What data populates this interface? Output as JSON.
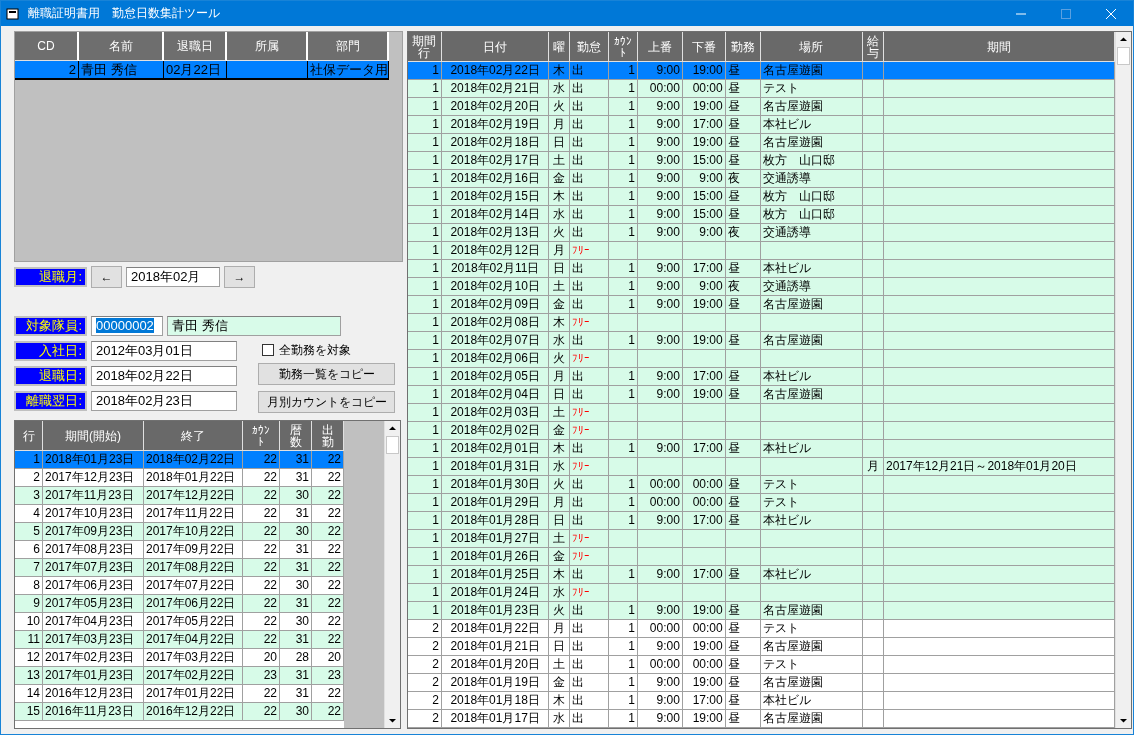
{
  "window": {
    "title": "離職証明書用　勤怠日数集計ツール"
  },
  "staff_table": {
    "columns": [
      "CD",
      "名前",
      "退職日",
      "所属",
      "部門"
    ],
    "rows": [
      {
        "cd": "2",
        "name": "青田 秀信",
        "retire_date": "02月22日",
        "department": "社保データ用",
        "selected": true
      }
    ]
  },
  "retire_month": {
    "label": "退職月:",
    "prev": "←",
    "value": "2018年02月",
    "next": "→"
  },
  "member": {
    "label": "対象隊員:",
    "code": "00000002",
    "name": "青田 秀信"
  },
  "dates": [
    {
      "label": "入社日:",
      "value": "2012年03月01日"
    },
    {
      "label": "退職日:",
      "value": "2018年02月22日"
    },
    {
      "label": "離職翌日:",
      "value": "2018年02月23日"
    }
  ],
  "all_shifts": {
    "label": "全勤務を対象",
    "checked": false
  },
  "buttons": [
    "勤務一覧をコピー",
    "月別カウントをコピー"
  ],
  "period_table": {
    "columns": [
      "行",
      "期間(開始)",
      "終了",
      "ｶｳﾝﾄ",
      "暦数",
      "出勤"
    ],
    "rows": [
      {
        "row": "1",
        "start": "2018年01月23日",
        "end": "2018年02月22日",
        "count": "22",
        "days": "31",
        "worked": "22",
        "selected": true,
        "shaded": false
      },
      {
        "row": "2",
        "start": "2017年12月23日",
        "end": "2018年01月22日",
        "count": "22",
        "days": "31",
        "worked": "22",
        "selected": false,
        "shaded": false
      },
      {
        "row": "3",
        "start": "2017年11月23日",
        "end": "2017年12月22日",
        "count": "22",
        "days": "30",
        "worked": "22",
        "selected": false,
        "shaded": true
      },
      {
        "row": "4",
        "start": "2017年10月23日",
        "end": "2017年11月22日",
        "count": "22",
        "days": "31",
        "worked": "22",
        "selected": false,
        "shaded": false
      },
      {
        "row": "5",
        "start": "2017年09月23日",
        "end": "2017年10月22日",
        "count": "22",
        "days": "30",
        "worked": "22",
        "selected": false,
        "shaded": true
      },
      {
        "row": "6",
        "start": "2017年08月23日",
        "end": "2017年09月22日",
        "count": "22",
        "days": "31",
        "worked": "22",
        "selected": false,
        "shaded": false
      },
      {
        "row": "7",
        "start": "2017年07月23日",
        "end": "2017年08月22日",
        "count": "22",
        "days": "31",
        "worked": "22",
        "selected": false,
        "shaded": true
      },
      {
        "row": "8",
        "start": "2017年06月23日",
        "end": "2017年07月22日",
        "count": "22",
        "days": "30",
        "worked": "22",
        "selected": false,
        "shaded": false
      },
      {
        "row": "9",
        "start": "2017年05月23日",
        "end": "2017年06月22日",
        "count": "22",
        "days": "31",
        "worked": "22",
        "selected": false,
        "shaded": true
      },
      {
        "row": "10",
        "start": "2017年04月23日",
        "end": "2017年05月22日",
        "count": "22",
        "days": "30",
        "worked": "22",
        "selected": false,
        "shaded": false
      },
      {
        "row": "11",
        "start": "2017年03月23日",
        "end": "2017年04月22日",
        "count": "22",
        "days": "31",
        "worked": "22",
        "selected": false,
        "shaded": true
      },
      {
        "row": "12",
        "start": "2017年02月23日",
        "end": "2017年03月22日",
        "count": "20",
        "days": "28",
        "worked": "20",
        "selected": false,
        "shaded": false
      },
      {
        "row": "13",
        "start": "2017年01月23日",
        "end": "2017年02月22日",
        "count": "23",
        "days": "31",
        "worked": "23",
        "selected": false,
        "shaded": true
      },
      {
        "row": "14",
        "start": "2016年12月23日",
        "end": "2017年01月22日",
        "count": "22",
        "days": "31",
        "worked": "22",
        "selected": false,
        "shaded": false
      },
      {
        "row": "15",
        "start": "2016年11月23日",
        "end": "2016年12月22日",
        "count": "22",
        "days": "30",
        "worked": "22",
        "selected": false,
        "shaded": true
      }
    ]
  },
  "attendance_table": {
    "columns": [
      "期間行",
      "日付",
      "曜",
      "勤怠",
      "ｶｳﾝﾄ",
      "上番",
      "下番",
      "勤務",
      "場所",
      "給与",
      "期間"
    ],
    "rows": [
      {
        "period": "1",
        "date": "2018年02月22日",
        "weekday": "木",
        "status": "出",
        "kind": "work",
        "count": "1",
        "start": "9:00",
        "end": "19:00",
        "shift": "昼",
        "place": "名古屋遊園",
        "selected": true,
        "shaded": true
      },
      {
        "period": "1",
        "date": "2018年02月21日",
        "weekday": "水",
        "status": "出",
        "kind": "work",
        "count": "1",
        "start": "00:00",
        "end": "00:00",
        "shift": "昼",
        "place": "テスト",
        "selected": false,
        "shaded": true
      },
      {
        "period": "1",
        "date": "2018年02月20日",
        "weekday": "火",
        "status": "出",
        "kind": "work",
        "count": "1",
        "start": "9:00",
        "end": "19:00",
        "shift": "昼",
        "place": "名古屋遊園",
        "selected": false,
        "shaded": true
      },
      {
        "period": "1",
        "date": "2018年02月19日",
        "weekday": "月",
        "status": "出",
        "kind": "work",
        "count": "1",
        "start": "9:00",
        "end": "17:00",
        "shift": "昼",
        "place": "本社ビル",
        "selected": false,
        "shaded": true
      },
      {
        "period": "1",
        "date": "2018年02月18日",
        "weekday": "日",
        "status": "出",
        "kind": "work",
        "count": "1",
        "start": "9:00",
        "end": "19:00",
        "shift": "昼",
        "place": "名古屋遊園",
        "selected": false,
        "shaded": true
      },
      {
        "period": "1",
        "date": "2018年02月17日",
        "weekday": "土",
        "status": "出",
        "kind": "work",
        "count": "1",
        "start": "9:00",
        "end": "15:00",
        "shift": "昼",
        "place": "枚方　山口邸",
        "selected": false,
        "shaded": true
      },
      {
        "period": "1",
        "date": "2018年02月16日",
        "weekday": "金",
        "status": "出",
        "kind": "work",
        "count": "1",
        "start": "9:00",
        "end": "9:00",
        "shift": "夜",
        "place": "交通誘導",
        "selected": false,
        "shaded": true
      },
      {
        "period": "1",
        "date": "2018年02月15日",
        "weekday": "木",
        "status": "出",
        "kind": "work",
        "count": "1",
        "start": "9:00",
        "end": "15:00",
        "shift": "昼",
        "place": "枚方　山口邸",
        "selected": false,
        "shaded": true
      },
      {
        "period": "1",
        "date": "2018年02月14日",
        "weekday": "水",
        "status": "出",
        "kind": "work",
        "count": "1",
        "start": "9:00",
        "end": "15:00",
        "shift": "昼",
        "place": "枚方　山口邸",
        "selected": false,
        "shaded": true
      },
      {
        "period": "1",
        "date": "2018年02月13日",
        "weekday": "火",
        "status": "出",
        "kind": "work",
        "count": "1",
        "start": "9:00",
        "end": "9:00",
        "shift": "夜",
        "place": "交通誘導",
        "selected": false,
        "shaded": true
      },
      {
        "period": "1",
        "date": "2018年02月12日",
        "weekday": "月",
        "status": "ﾌﾘｰ",
        "kind": "free",
        "selected": false,
        "shaded": true
      },
      {
        "period": "1",
        "date": "2018年02月11日",
        "weekday": "日",
        "status": "出",
        "kind": "work",
        "count": "1",
        "start": "9:00",
        "end": "17:00",
        "shift": "昼",
        "place": "本社ビル",
        "selected": false,
        "shaded": true
      },
      {
        "period": "1",
        "date": "2018年02月10日",
        "weekday": "土",
        "status": "出",
        "kind": "work",
        "count": "1",
        "start": "9:00",
        "end": "9:00",
        "shift": "夜",
        "place": "交通誘導",
        "selected": false,
        "shaded": true
      },
      {
        "period": "1",
        "date": "2018年02月09日",
        "weekday": "金",
        "status": "出",
        "kind": "work",
        "count": "1",
        "start": "9:00",
        "end": "19:00",
        "shift": "昼",
        "place": "名古屋遊園",
        "selected": false,
        "shaded": true
      },
      {
        "period": "1",
        "date": "2018年02月08日",
        "weekday": "木",
        "status": "ﾌﾘｰ",
        "kind": "free",
        "selected": false,
        "shaded": true
      },
      {
        "period": "1",
        "date": "2018年02月07日",
        "weekday": "水",
        "status": "出",
        "kind": "work",
        "count": "1",
        "start": "9:00",
        "end": "19:00",
        "shift": "昼",
        "place": "名古屋遊園",
        "selected": false,
        "shaded": true
      },
      {
        "period": "1",
        "date": "2018年02月06日",
        "weekday": "火",
        "status": "ﾌﾘｰ",
        "kind": "free",
        "selected": false,
        "shaded": true
      },
      {
        "period": "1",
        "date": "2018年02月05日",
        "weekday": "月",
        "status": "出",
        "kind": "work",
        "count": "1",
        "start": "9:00",
        "end": "17:00",
        "shift": "昼",
        "place": "本社ビル",
        "selected": false,
        "shaded": true
      },
      {
        "period": "1",
        "date": "2018年02月04日",
        "weekday": "日",
        "status": "出",
        "kind": "work",
        "count": "1",
        "start": "9:00",
        "end": "19:00",
        "shift": "昼",
        "place": "名古屋遊園",
        "selected": false,
        "shaded": true
      },
      {
        "period": "1",
        "date": "2018年02月03日",
        "weekday": "土",
        "status": "ﾌﾘｰ",
        "kind": "free",
        "selected": false,
        "shaded": true
      },
      {
        "period": "1",
        "date": "2018年02月02日",
        "weekday": "金",
        "status": "ﾌﾘｰ",
        "kind": "free",
        "selected": false,
        "shaded": true
      },
      {
        "period": "1",
        "date": "2018年02月01日",
        "weekday": "木",
        "status": "出",
        "kind": "work",
        "count": "1",
        "start": "9:00",
        "end": "17:00",
        "shift": "昼",
        "place": "本社ビル",
        "selected": false,
        "shaded": true
      },
      {
        "period": "1",
        "date": "2018年01月31日",
        "weekday": "水",
        "status": "ﾌﾘｰ",
        "kind": "free",
        "pay": "月",
        "pay_period": "2017年12月21日～2018年01月20日",
        "selected": false,
        "shaded": true
      },
      {
        "period": "1",
        "date": "2018年01月30日",
        "weekday": "火",
        "status": "出",
        "kind": "work",
        "count": "1",
        "start": "00:00",
        "end": "00:00",
        "shift": "昼",
        "place": "テスト",
        "selected": false,
        "shaded": true
      },
      {
        "period": "1",
        "date": "2018年01月29日",
        "weekday": "月",
        "status": "出",
        "kind": "work",
        "count": "1",
        "start": "00:00",
        "end": "00:00",
        "shift": "昼",
        "place": "テスト",
        "selected": false,
        "shaded": true
      },
      {
        "period": "1",
        "date": "2018年01月28日",
        "weekday": "日",
        "status": "出",
        "kind": "work",
        "count": "1",
        "start": "9:00",
        "end": "17:00",
        "shift": "昼",
        "place": "本社ビル",
        "selected": false,
        "shaded": true
      },
      {
        "period": "1",
        "date": "2018年01月27日",
        "weekday": "土",
        "status": "ﾌﾘｰ",
        "kind": "free",
        "selected": false,
        "shaded": true
      },
      {
        "period": "1",
        "date": "2018年01月26日",
        "weekday": "金",
        "status": "ﾌﾘｰ",
        "kind": "free",
        "selected": false,
        "shaded": true
      },
      {
        "period": "1",
        "date": "2018年01月25日",
        "weekday": "木",
        "status": "出",
        "kind": "work",
        "count": "1",
        "start": "9:00",
        "end": "17:00",
        "shift": "昼",
        "place": "本社ビル",
        "selected": false,
        "shaded": true
      },
      {
        "period": "1",
        "date": "2018年01月24日",
        "weekday": "水",
        "status": "ﾌﾘｰ",
        "kind": "free",
        "selected": false,
        "shaded": true
      },
      {
        "period": "1",
        "date": "2018年01月23日",
        "weekday": "火",
        "status": "出",
        "kind": "work",
        "count": "1",
        "start": "9:00",
        "end": "19:00",
        "shift": "昼",
        "place": "名古屋遊園",
        "selected": false,
        "shaded": true
      },
      {
        "period": "2",
        "date": "2018年01月22日",
        "weekday": "月",
        "status": "出",
        "kind": "work",
        "count": "1",
        "start": "00:00",
        "end": "00:00",
        "shift": "昼",
        "place": "テスト",
        "selected": false,
        "shaded": false
      },
      {
        "period": "2",
        "date": "2018年01月21日",
        "weekday": "日",
        "status": "出",
        "kind": "work",
        "count": "1",
        "start": "9:00",
        "end": "19:00",
        "shift": "昼",
        "place": "名古屋遊園",
        "selected": false,
        "shaded": false
      },
      {
        "period": "2",
        "date": "2018年01月20日",
        "weekday": "土",
        "status": "出",
        "kind": "work",
        "count": "1",
        "start": "00:00",
        "end": "00:00",
        "shift": "昼",
        "place": "テスト",
        "selected": false,
        "shaded": false
      },
      {
        "period": "2",
        "date": "2018年01月19日",
        "weekday": "金",
        "status": "出",
        "kind": "work",
        "count": "1",
        "start": "9:00",
        "end": "19:00",
        "shift": "昼",
        "place": "名古屋遊園",
        "selected": false,
        "shaded": false
      },
      {
        "period": "2",
        "date": "2018年01月18日",
        "weekday": "木",
        "status": "出",
        "kind": "work",
        "count": "1",
        "start": "9:00",
        "end": "17:00",
        "shift": "昼",
        "place": "本社ビル",
        "selected": false,
        "shaded": false
      },
      {
        "period": "2",
        "date": "2018年01月17日",
        "weekday": "水",
        "status": "出",
        "kind": "work",
        "count": "1",
        "start": "9:00",
        "end": "19:00",
        "shift": "昼",
        "place": "名古屋遊園",
        "selected": false,
        "shaded": false
      }
    ]
  }
}
